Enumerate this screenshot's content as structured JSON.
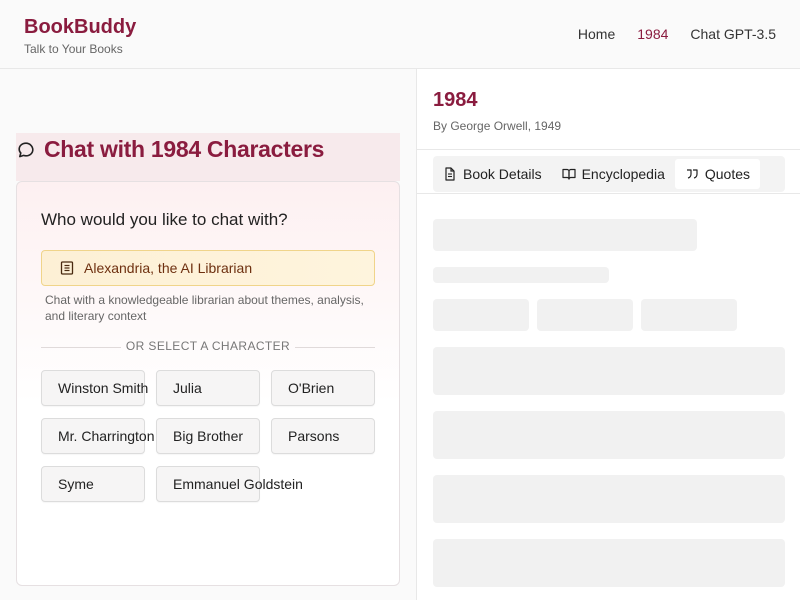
{
  "header": {
    "brand": "BookBuddy",
    "tagline": "Talk to Your Books",
    "nav": [
      {
        "label": "Home",
        "active": false
      },
      {
        "label": "1984",
        "active": true
      },
      {
        "label": "Chat GPT-3.5",
        "active": false
      }
    ]
  },
  "chat": {
    "title": "Chat with 1984 Characters",
    "question": "Who would you like to chat with?",
    "librarian": {
      "label": "Alexandria, the AI Librarian",
      "description": "Chat with a knowledgeable librarian about themes, analysis, and literary context"
    },
    "divider": "OR SELECT A CHARACTER",
    "characters": [
      "Winston Smith",
      "Julia",
      "O'Brien",
      "Mr. Charrington",
      "Big Brother",
      "Parsons",
      "Syme",
      "Emmanuel Goldstein"
    ]
  },
  "book": {
    "title": "1984",
    "meta": "By George Orwell, 1949",
    "tabs": [
      {
        "label": "Book Details",
        "icon": "document-icon"
      },
      {
        "label": "Encyclopedia",
        "icon": "open-book-icon"
      },
      {
        "label": "Quotes",
        "icon": "quote-icon",
        "active": true
      }
    ]
  },
  "colors": {
    "brand": "#8a1c3f",
    "librarian_bg": "#fdf0d5",
    "skeleton": "#f1f1f1"
  }
}
